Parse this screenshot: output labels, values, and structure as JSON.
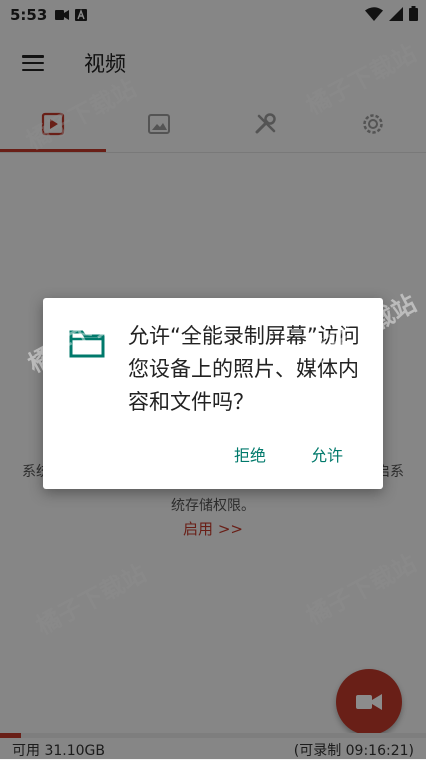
{
  "status_bar": {
    "time": "5:53"
  },
  "app_bar": {
    "title": "视频"
  },
  "tabs": [
    {
      "name": "video",
      "icon": "video-play-icon",
      "selected": true
    },
    {
      "name": "images",
      "icon": "image-icon",
      "selected": false
    },
    {
      "name": "tools",
      "icon": "tools-icon",
      "selected": false
    },
    {
      "name": "settings",
      "icon": "gear-icon",
      "selected": false
    }
  ],
  "content": {
    "system_note_line1_left": "系统",
    "system_note_line1_right": "启系",
    "system_note_line2": "统存储权限。",
    "enable_link": "启用 >>"
  },
  "bottom": {
    "available": "可用 31.10GB",
    "remaining": "(可录制 09:16:21)",
    "storage_used_fraction": 0.05
  },
  "dialog": {
    "message": "允许“全能录制屏幕”访问您设备上的照片、媒体内容和文件吗？",
    "deny_label": "拒绝",
    "allow_label": "允许"
  },
  "watermark": {
    "text": "橘子下载站"
  },
  "colors": {
    "accent": "#c0392b",
    "dialog_button": "#00796b",
    "folder_icon": "#00796b"
  }
}
